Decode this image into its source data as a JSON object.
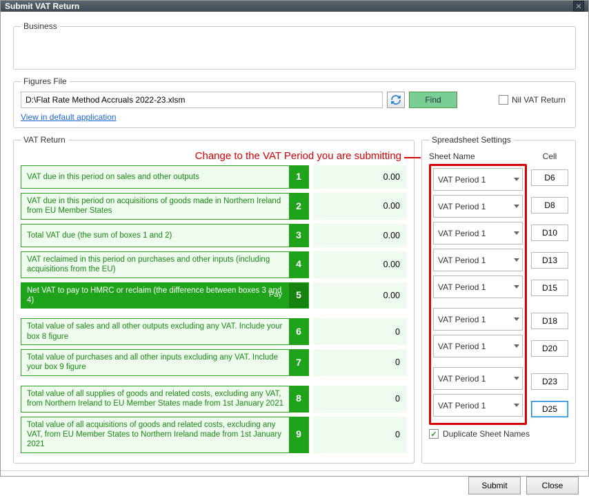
{
  "window": {
    "title": "Submit VAT Return"
  },
  "business": {
    "legend": "Business"
  },
  "figures": {
    "legend": "Figures File",
    "path": "D:\\Flat Rate Method Accruals 2022-23.xlsm",
    "find_label": "Find",
    "nil_label": "Nil VAT Return",
    "nil_checked": false,
    "view_link": "View in default application"
  },
  "annotation": "Change to the VAT Period you are submitting",
  "vat_return": {
    "legend": "VAT Return",
    "rows": [
      {
        "num": "1",
        "label": "VAT due in this period on sales and other outputs",
        "value": "0.00",
        "dark": false
      },
      {
        "num": "2",
        "label": "VAT due in this period on acquisitions of goods made in Northern Ireland from EU Member States",
        "value": "0.00",
        "dark": false
      },
      {
        "num": "3",
        "label": "Total VAT due (the sum of boxes 1 and 2)",
        "value": "0.00",
        "dark": false
      },
      {
        "num": "4",
        "label": "VAT reclaimed in this period on purchases and other inputs (including acquisitions from the EU)",
        "value": "0.00",
        "dark": false
      },
      {
        "num": "5",
        "label": "Net VAT to pay to HMRC or reclaim (the difference between boxes 3 and 4)",
        "value": "0.00",
        "dark": true,
        "pay": "Pay"
      },
      {
        "num": "6",
        "label": "Total value of sales and all other outputs excluding any VAT. Include your box 8 figure",
        "value": "0",
        "dark": false
      },
      {
        "num": "7",
        "label": "Total value of purchases and all other inputs excluding any VAT. Include your box 9 figure",
        "value": "0",
        "dark": false
      },
      {
        "num": "8",
        "label": "Total value of all supplies of goods and related costs, excluding any VAT, from Northern Ireland to EU Member States made from 1st January 2021",
        "value": "0",
        "dark": false
      },
      {
        "num": "9",
        "label": "Total value of all acquisitions of goods and related costs, excluding any VAT, from EU Member States to Northern Ireland made from 1st January 2021",
        "value": "0",
        "dark": false
      }
    ]
  },
  "spreadsheet": {
    "legend": "Spreadsheet Settings",
    "sheet_header": "Sheet Name",
    "cell_header": "Cell",
    "rows": [
      {
        "sheet": "VAT Period 1",
        "cell": "D6"
      },
      {
        "sheet": "VAT Period 1",
        "cell": "D8"
      },
      {
        "sheet": "VAT Period 1",
        "cell": "D10"
      },
      {
        "sheet": "VAT Period 1",
        "cell": "D13"
      },
      {
        "sheet": "VAT Period 1",
        "cell": "D15"
      },
      {
        "sheet": "VAT Period 1",
        "cell": "D18"
      },
      {
        "sheet": "VAT Period 1",
        "cell": "D20"
      },
      {
        "sheet": "VAT Period 1",
        "cell": "D23"
      },
      {
        "sheet": "VAT Period 1",
        "cell": "D25"
      }
    ],
    "duplicate_label": "Duplicate Sheet Names",
    "duplicate_checked": true
  },
  "footer": {
    "submit": "Submit",
    "close": "Close"
  }
}
